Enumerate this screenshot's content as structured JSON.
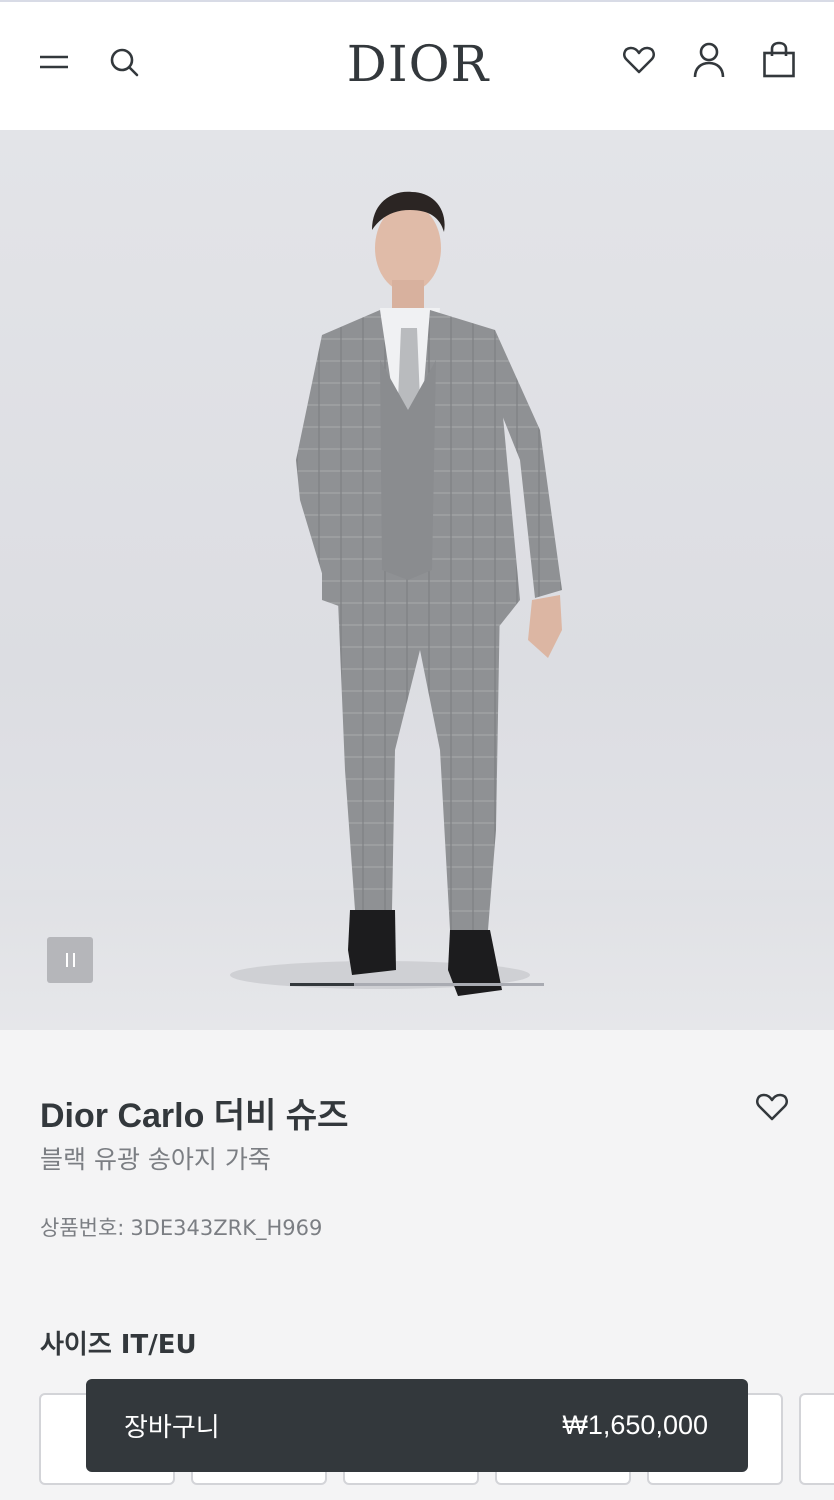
{
  "header": {
    "logo": "DIOR",
    "icons": [
      "menu-icon",
      "search-icon",
      "wishlist-icon",
      "account-icon",
      "shopping-bag-icon"
    ]
  },
  "gallery": {
    "image_alt": "",
    "slide_progress": 0.25,
    "control": "pause-icon"
  },
  "product": {
    "title": "Dior Carlo 더비 슈즈",
    "subtitle": "블랙 유광 송아지 가죽",
    "sku_label": "상품번호:",
    "sku_value": "3DE343ZRK_H969"
  },
  "size": {
    "label": "사이즈 IT/EU",
    "options": [
      "",
      "",
      "",
      "",
      "",
      ""
    ]
  },
  "cart": {
    "label": "장바구니",
    "price": "₩1,650,000"
  },
  "colors": {
    "text_primary": "#33383c",
    "text_secondary": "#7b7e83",
    "button_dark": "#33383c"
  }
}
